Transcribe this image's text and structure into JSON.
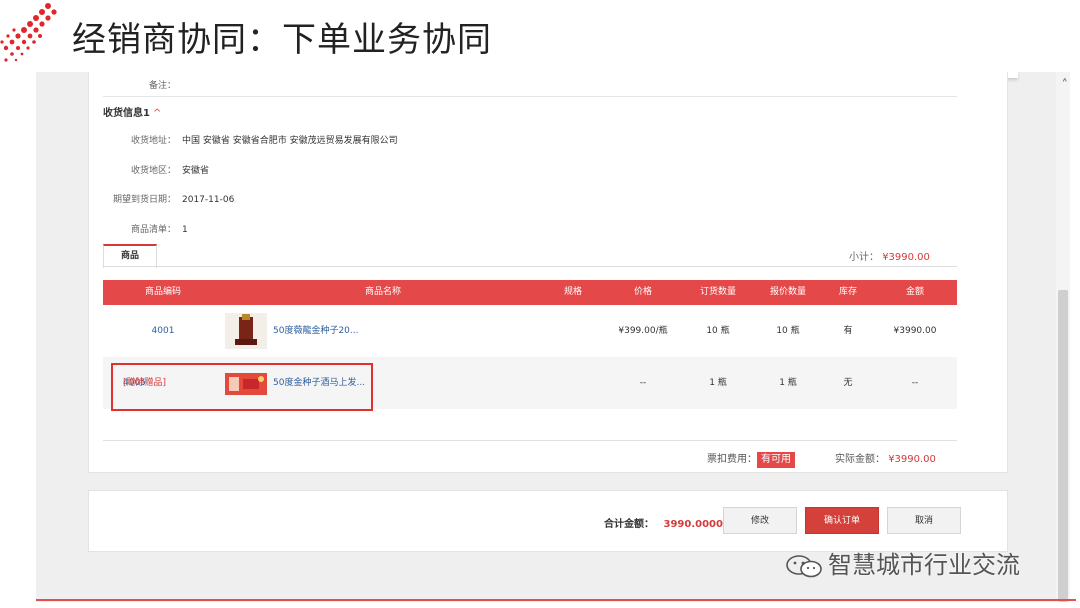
{
  "slide": {
    "title": "经销商协同：下单业务协同"
  },
  "remark": {
    "label": "备注：",
    "value": ""
  },
  "section": {
    "title": "收货信息1",
    "caret": "^"
  },
  "address": {
    "label": "收货地址：",
    "value": "中国 安徽省 安徽省合肥市 安徽茂远贸易发展有限公司"
  },
  "region": {
    "label": "收货地区：",
    "value": "安徽省"
  },
  "date": {
    "label": "期望到货日期：",
    "value": "2017-11-06"
  },
  "items_count": {
    "label": "商品清单：",
    "value": "1"
  },
  "tab": {
    "label": "商品"
  },
  "subtotal": {
    "label": "小计：",
    "value": "¥3990.00"
  },
  "table": {
    "headers": [
      "商品编码",
      "商品名称",
      "规格",
      "价格",
      "订货数量",
      "报价数量",
      "库存",
      "金额"
    ],
    "rows": [
      {
        "code": "4001",
        "tag": "",
        "name": "50度薇龍金种子20...",
        "spec": "",
        "price": "¥399.00/瓶",
        "order_qty": "10 瓶",
        "quote_qty": "10 瓶",
        "stock": "有",
        "amount": "¥3990.00"
      },
      {
        "code": "4005",
        "tag": "[赠除赠品]",
        "name": "50度金种子酒马上发...",
        "spec": "",
        "price": "--",
        "order_qty": "1 瓶",
        "quote_qty": "1 瓶",
        "stock": "无",
        "amount": "--"
      }
    ]
  },
  "fees": {
    "deduct_label": "票扣费用：",
    "deduct_tag": "有可用",
    "actual_label": "实际金额：",
    "actual_value": "¥3990.00"
  },
  "footer": {
    "total_label": "合计金额：",
    "total_value": "3990.0000",
    "edit": "修改",
    "confirm": "确认订单",
    "cancel": "取消"
  },
  "watermark": {
    "text": "智慧城市行业交流"
  },
  "colors": {
    "accent": "#d43a3a",
    "table_header": "#e54848",
    "link": "#2f5f9f"
  }
}
